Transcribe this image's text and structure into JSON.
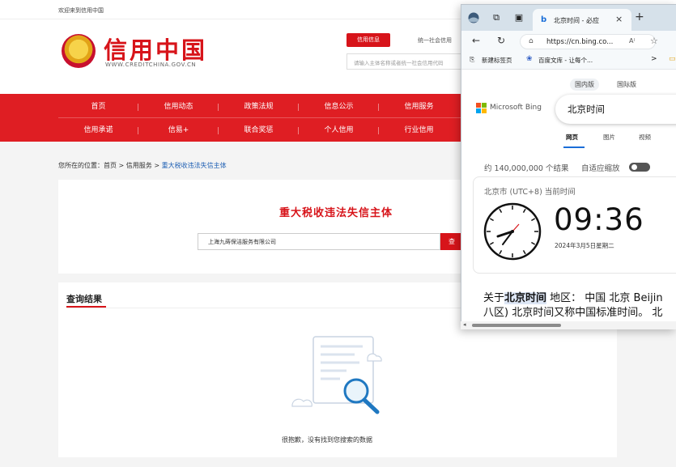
{
  "site": {
    "welcome": "欢迎来到信用中国",
    "logo_title": "信用中国",
    "logo_url": "WWW.CREDITCHINA.GOV.CN",
    "tag_active": "信用信息",
    "tag_other": "统一社会信用",
    "search_placeholder": "请输入主体名称或者统一社会信用代码",
    "nav_row1": [
      "首页",
      "信用动态",
      "政策法规",
      "信息公示",
      "信用服务"
    ],
    "nav_row2": [
      "信用承诺",
      "信易+",
      "联合奖惩",
      "个人信用",
      "行业信用"
    ],
    "breadcrumb": {
      "prefix": "您所在的位置：",
      "home": "首页",
      "sep1": " > ",
      "service": "信用服务",
      "sep2": " > ",
      "current": "重大税收违法失信主体"
    },
    "query_title": "重大税收违法失信主体",
    "query_value": "上海九蒔保洁服务有限公司",
    "query_button": "查",
    "result_title": "查询结果",
    "empty_text": "很抱歉，没有找到您搜索的数据"
  },
  "browser": {
    "tab_title": "北京时间 - 必应",
    "tab_close": "×",
    "new_tab": "+",
    "url": "https://cn.bing.co...",
    "read_aloud": "A⁾",
    "favorites": [
      "新建标签页",
      "百度文库 - 让每个..."
    ],
    "fav_more": ">",
    "bing": {
      "scopes": [
        "国内版",
        "国际版"
      ],
      "brand": "Microsoft Bing",
      "query": "北京时间",
      "tabs": [
        "网页",
        "图片",
        "视频"
      ],
      "result_count": "约 140,000,000 个结果",
      "adaptive_zoom": "自适应缩放",
      "location": "北京市 (UTC+8) 当前时间",
      "time": "09:36",
      "date": "2024年3月5日星期二",
      "snippet_prefix": "关于",
      "snippet_bold": "北京时间",
      "snippet_rest": " 地区： 中国 北京 Beijin",
      "snippet_line2": "八区) 北京时间又称中国标准时间。 北"
    }
  },
  "icons": {
    "back": "←",
    "refresh": "↻",
    "lock": "🔒",
    "star": "☆",
    "search": "magnifier-icon"
  },
  "colors": {
    "brand_red": "#df1e23",
    "bing_blue": "#1a6ed8"
  }
}
